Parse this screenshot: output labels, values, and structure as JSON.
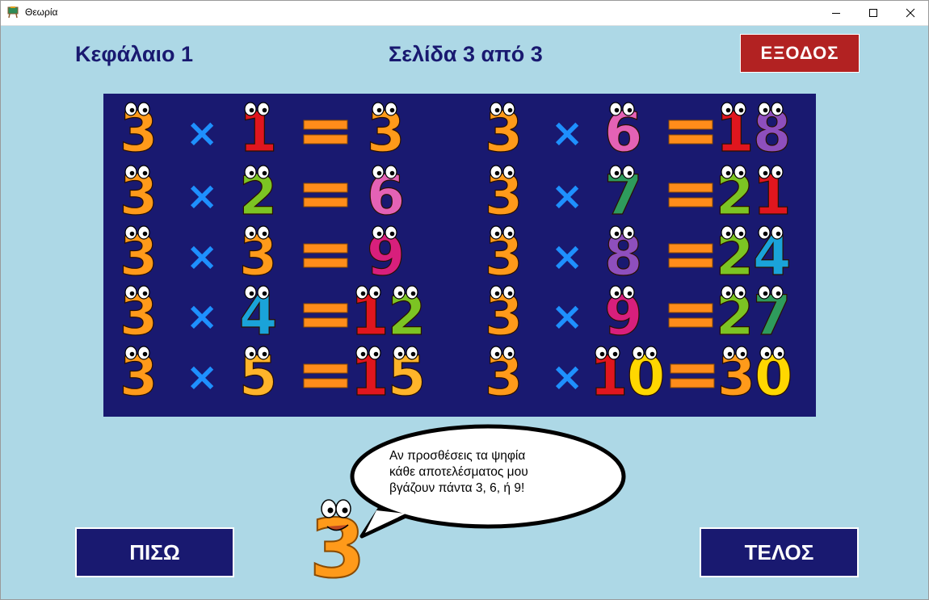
{
  "window": {
    "title": "Θεωρία",
    "icon": "easel-icon"
  },
  "header": {
    "chapter": "Κεφάλαιο 1",
    "page_indicator": "Σελίδα 3 από 3",
    "exit_label": "ΕΞΟΔΟΣ"
  },
  "colors": {
    "background": "#add8e6",
    "board": "#191970",
    "exit": "#b22222",
    "nav": "#191970",
    "operator": "#1e90ff",
    "equals": "#ff8c1a"
  },
  "table": {
    "multiplicand": "3",
    "operator": "×",
    "equals": "=",
    "rows": [
      {
        "multiplier": "1",
        "result": "3"
      },
      {
        "multiplier": "2",
        "result": "6"
      },
      {
        "multiplier": "3",
        "result": "9"
      },
      {
        "multiplier": "4",
        "result": "12"
      },
      {
        "multiplier": "5",
        "result": "15"
      },
      {
        "multiplier": "6",
        "result": "18"
      },
      {
        "multiplier": "7",
        "result": "21"
      },
      {
        "multiplier": "8",
        "result": "24"
      },
      {
        "multiplier": "9",
        "result": "27"
      },
      {
        "multiplier": "10",
        "result": "30"
      }
    ],
    "digit_colors": {
      "0": "#ffd700",
      "1": "#e0161e",
      "2": "#7cc423",
      "3": "#ff9a1a",
      "4": "#1aa3d9",
      "5": "#ffb42a",
      "6": "#e462b5",
      "7": "#2e9b5c",
      "8": "#8e4fbd",
      "9": "#d81f7c"
    }
  },
  "speech_bubble": {
    "line1": "Αν προσθέσεις τα ψηφία",
    "line2": "κάθε αποτελέσματος μου",
    "line3": "βγάζουν πάντα 3, 6, ή 9!"
  },
  "mascot": {
    "name": "number-three-mascot-icon",
    "digit": "3"
  },
  "nav": {
    "back_label": "ΠΙΣΩ",
    "end_label": "ΤΕΛΟΣ"
  }
}
